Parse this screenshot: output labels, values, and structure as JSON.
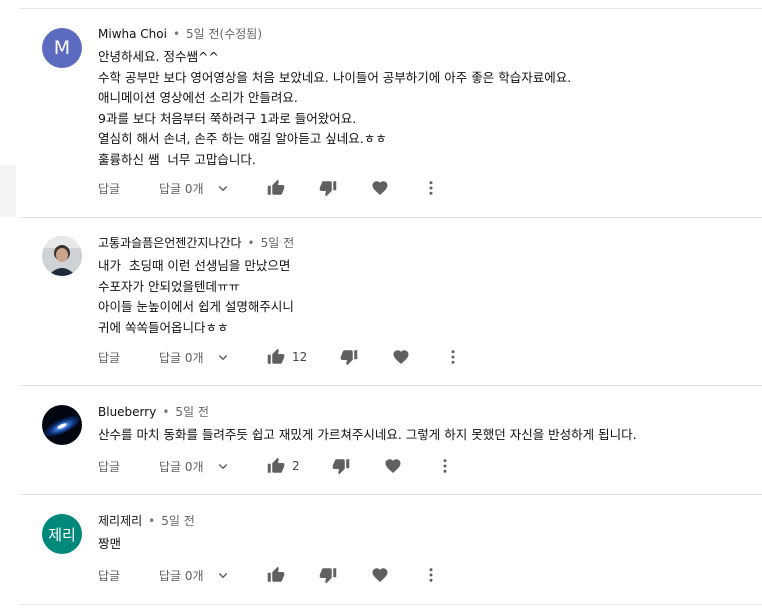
{
  "comments": [
    {
      "author": "Miwha Choi",
      "time": "5일 전(수정됨)",
      "avatar_letter": "M",
      "avatar_color": "#5c6bc0",
      "lines": [
        "안녕하세요. 정수쌤^^",
        "수학 공부만 보다 영어영상을 처음 보았네요. 나이들어 공부하기에 아주 좋은 학습자료에요.",
        "애니메이션 영상에선 소리가 안들려요.",
        "9과를 보다 처음부터 쭉하려구 1과로 들어왔어요.",
        "열심히 해서 손녀, 손주 하는 얘길 알아듣고 싶네요.ㅎㅎ",
        "훌륭하신 쌤  너무 고맙습니다."
      ],
      "reply": "답글",
      "replies": "답글 0개",
      "likes": ""
    },
    {
      "author": "고통과슬픔은언젠간지나간다",
      "time": "5일 전",
      "avatar_letter": "",
      "avatar_color": "#9e9e9e",
      "lines": [
        "내가  초딩때 이런 선생님을 만났으면",
        "수포자가 안되었을텐데ㅠㅠ",
        "아이들 눈높이에서 쉽게 설명해주시니",
        "귀에 쏙쏙들어옵니다ㅎㅎ"
      ],
      "reply": "답글",
      "replies": "답글 0개",
      "likes": "12"
    },
    {
      "author": "Blueberry",
      "time": "5일 전",
      "avatar_letter": "",
      "avatar_color": "#0b1a3a",
      "lines": [
        "산수를 마치 동화를 들려주듯 쉽고 재밌게 가르쳐주시네요. 그렇게 하지 못했던 자신을 반성하게 됩니다."
      ],
      "reply": "답글",
      "replies": "답글 0개",
      "likes": "2"
    },
    {
      "author": "제리제리",
      "time": "5일 전",
      "avatar_letter": "제리",
      "avatar_color": "#00897b",
      "lines": [
        "짱맨"
      ],
      "reply": "답글",
      "replies": "답글 0개",
      "likes": ""
    }
  ],
  "icons": {
    "like": "thumb-up-icon",
    "dislike": "thumb-down-icon",
    "heart": "heart-icon",
    "more": "more-vert-icon",
    "expand": "chevron-down-icon"
  },
  "icon_color": "#606060"
}
